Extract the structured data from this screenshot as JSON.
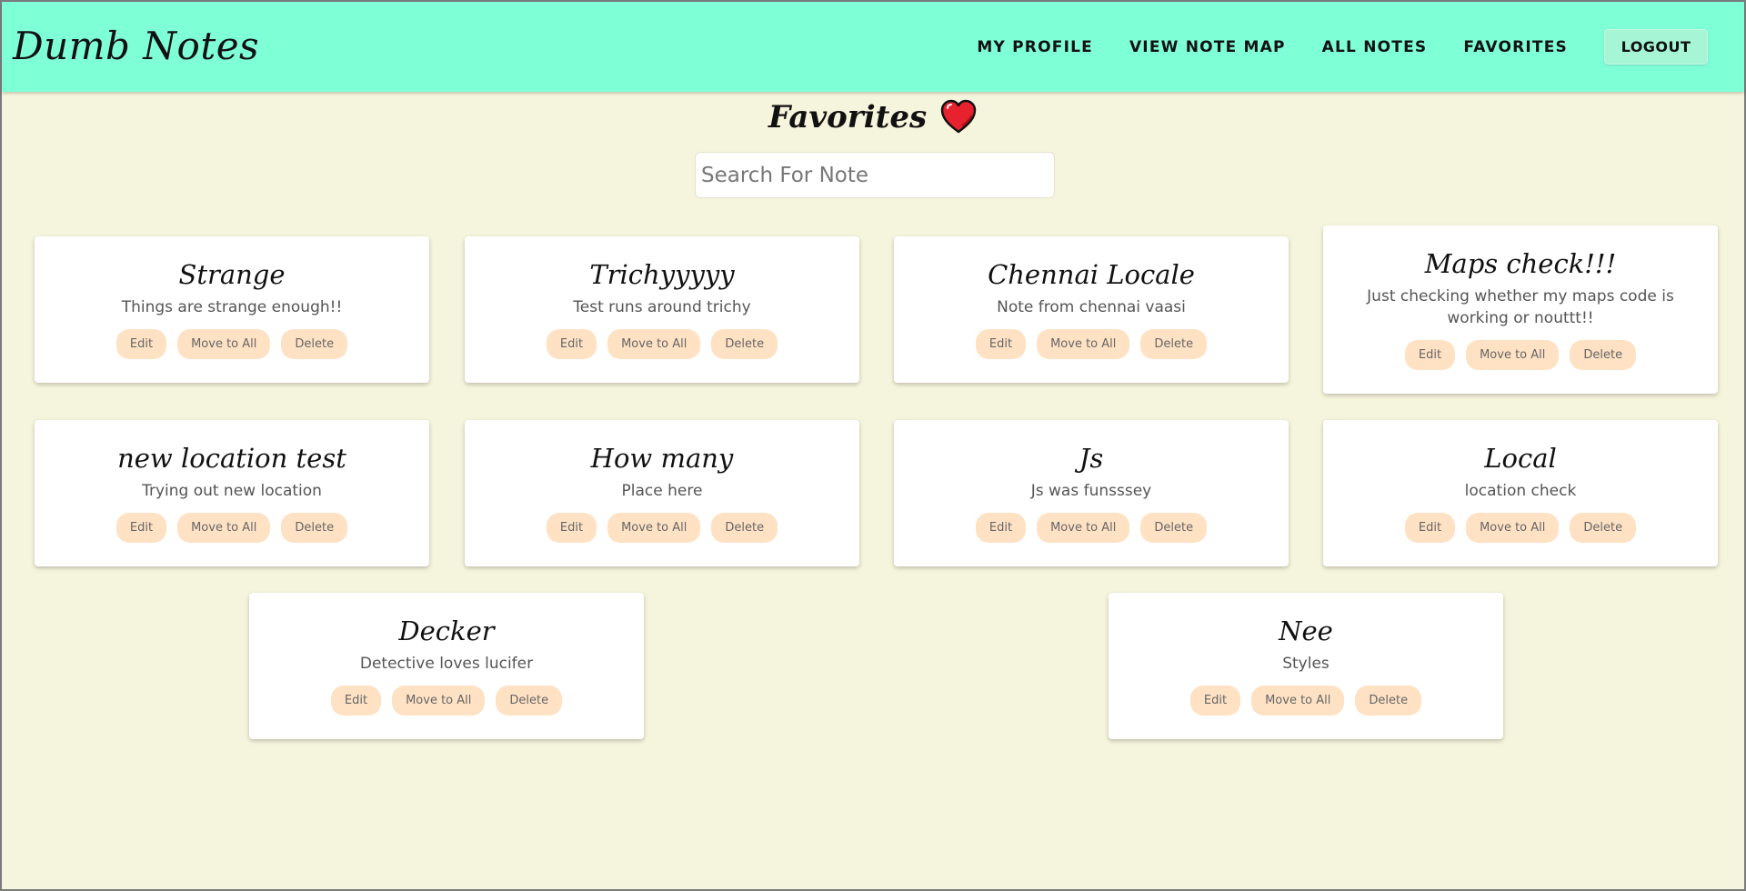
{
  "navbar": {
    "brand": "Dumb Notes",
    "links": [
      "MY PROFILE",
      "VIEW NOTE MAP",
      "ALL NOTES",
      "FAVORITES"
    ],
    "logout_label": "LOGOUT"
  },
  "page": {
    "title": "Favorites",
    "title_icon": "heart-icon"
  },
  "search": {
    "placeholder": "Search For Note",
    "value": ""
  },
  "actions": {
    "edit_label": "Edit",
    "move_label": "Move to All",
    "delete_label": "Delete"
  },
  "notes": [
    {
      "title": "Strange",
      "text": "Things are strange enough!!"
    },
    {
      "title": "Trichyyyyy",
      "text": "Test runs around trichy"
    },
    {
      "title": "Chennai Locale",
      "text": "Note from chennai vaasi"
    },
    {
      "title": "Maps check!!!",
      "text": "Just checking whether my maps code is working or nouttt!!"
    },
    {
      "title": "new location test",
      "text": "Trying out new location"
    },
    {
      "title": "How many",
      "text": "Place here"
    },
    {
      "title": "Js",
      "text": "Js was funsssey"
    },
    {
      "title": "Local",
      "text": "location check"
    },
    {
      "title": "Decker",
      "text": "Detective loves lucifer"
    },
    {
      "title": "Nee",
      "text": "Styles"
    }
  ],
  "colors": {
    "navbar_bg": "#7fffd6",
    "page_bg": "#f5f4dc",
    "button_bg": "#ffe2c4",
    "heart": "#e8212e"
  }
}
